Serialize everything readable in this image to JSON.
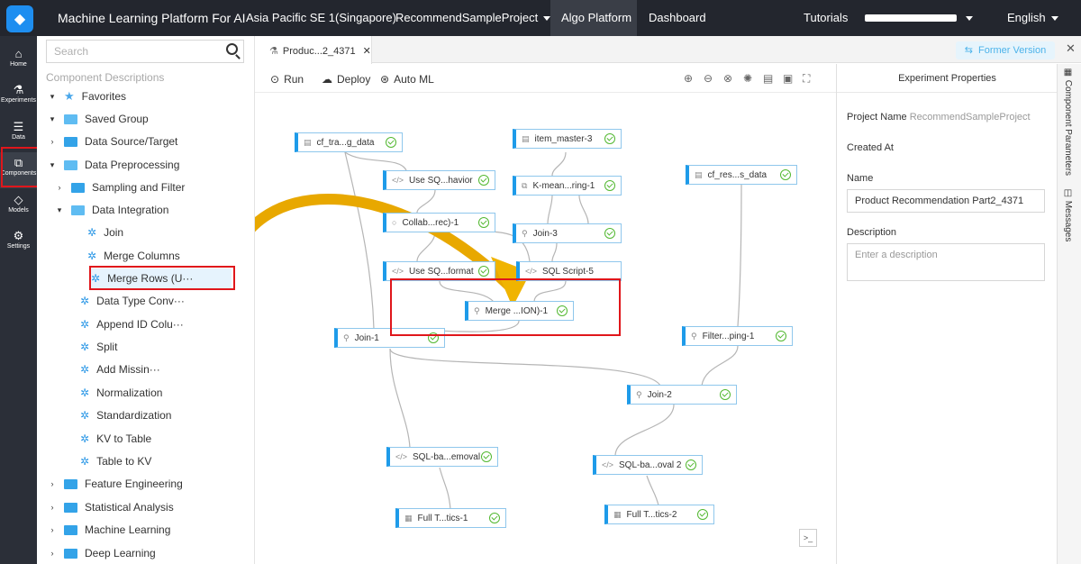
{
  "topbar": {
    "logo": "",
    "product": "Machine Learning Platform For AI",
    "region": "Asia Pacific SE 1(Singapore)",
    "project": "RecommendSampleProject",
    "algo": "Algo Platform",
    "dashboard": "Dashboard",
    "tutorials": "Tutorials",
    "language": "English"
  },
  "leftnav": [
    {
      "label": "Home",
      "icon": "home-icon"
    },
    {
      "label": "Experiments",
      "icon": "flask-icon"
    },
    {
      "label": "Data",
      "icon": "database-icon"
    },
    {
      "label": "Components",
      "icon": "puzzle-icon"
    },
    {
      "label": "Models",
      "icon": "diamond-icon"
    },
    {
      "label": "Settings",
      "icon": "gear-icon"
    }
  ],
  "panel": {
    "search_placeholder": "Search",
    "heading": "Component Descriptions",
    "tree": [
      {
        "label": "Favorites"
      },
      {
        "label": "Saved Group"
      },
      {
        "label": "Data Source/Target"
      },
      {
        "label": "Data Preprocessing"
      },
      {
        "label": "Sampling and Filter"
      },
      {
        "label": "Data Integration"
      },
      {
        "label": "Join"
      },
      {
        "label": "Merge Columns"
      },
      {
        "label": "Merge Rows (U···"
      },
      {
        "label": "Data Type Conv···"
      },
      {
        "label": "Append ID Colu···"
      },
      {
        "label": "Split"
      },
      {
        "label": "Add Missin···"
      },
      {
        "label": "Normalization"
      },
      {
        "label": "Standardization"
      },
      {
        "label": "KV to Table"
      },
      {
        "label": "Table to KV"
      },
      {
        "label": "Feature Engineering"
      },
      {
        "label": "Statistical Analysis"
      },
      {
        "label": "Machine Learning"
      },
      {
        "label": "Deep Learning"
      }
    ]
  },
  "tabbar": {
    "tab_label": "Produc...2_4371",
    "former_version": "Former Version"
  },
  "toolbar": {
    "run": "Run",
    "deploy": "Deploy",
    "automl": "Auto ML"
  },
  "canvas": {
    "nodes": [
      {
        "label": "cf_tra...g_data"
      },
      {
        "label": "item_master-3"
      },
      {
        "label": "Use SQ...havior"
      },
      {
        "label": "K-mean...ring-1"
      },
      {
        "label": "cf_res...s_data"
      },
      {
        "label": "Collab...rec)-1"
      },
      {
        "label": "Join-3"
      },
      {
        "label": "Use SQ...format"
      },
      {
        "label": "SQL Script-5"
      },
      {
        "label": "Merge ...ION)-1"
      },
      {
        "label": "Join-1"
      },
      {
        "label": "Filter...ping-1"
      },
      {
        "label": "Join-2"
      },
      {
        "label": "SQL-ba...emoval"
      },
      {
        "label": "SQL-ba...oval 2"
      },
      {
        "label": "Full T...tics-1"
      },
      {
        "label": "Full T...tics-2"
      }
    ]
  },
  "props": {
    "header": "Experiment Properties",
    "project_name_label": "Project Name",
    "project_name_value": "RecommendSampleProject",
    "created_at_label": "Created At",
    "name_label": "Name",
    "name_value": "Product Recommendation Part2_4371",
    "description_label": "Description",
    "description_placeholder": "Enter a description"
  },
  "rside": {
    "component_parameters": "Component Parameters",
    "messages": "Messages"
  },
  "colors": {
    "accent": "#1e9be9",
    "success": "#52b830",
    "highlight": "#e0161b",
    "arrow": "#e8a800"
  }
}
